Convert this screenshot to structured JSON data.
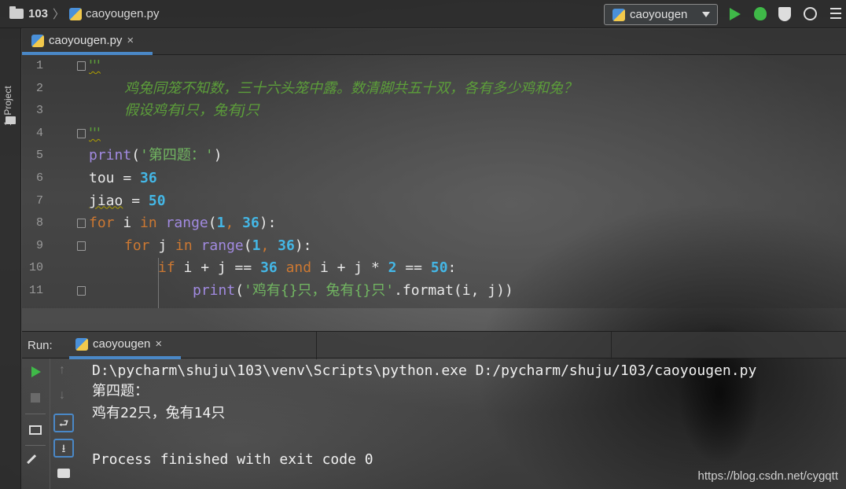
{
  "navbar": {
    "folder": "103",
    "file": "caoyougen.py",
    "run_config": "caoyougen"
  },
  "left_strip": {
    "project_tab": "1: Project"
  },
  "editor_tab": {
    "label": "caoyougen.py",
    "close": "×"
  },
  "editor": {
    "line_numbers": [
      "1",
      "2",
      "3",
      "4",
      "5",
      "6",
      "7",
      "8",
      "9",
      "10",
      "11"
    ],
    "doc_open": "'''",
    "doc_line1": "鸡兔同笼不知数，三十六头笼中露。数清脚共五十双，各有多少鸡和兔？",
    "doc_line2": "假设鸡有i只，兔有j只",
    "doc_close": "'''",
    "l5": {
      "fn": "print",
      "p1": "(",
      "str": "'第四题：'",
      "p2": ")"
    },
    "l6": {
      "var": "tou",
      "op": " = ",
      "num": "36"
    },
    "l7": {
      "var": "jiao",
      "op": " = ",
      "num": "50"
    },
    "l8": {
      "kw1": "for",
      "v": " i ",
      "kw2": "in",
      "sp": " ",
      "fn": "range",
      "p1": "(",
      "n1": "1",
      "c": ", ",
      "n2": "36",
      "p2": "):"
    },
    "l9": {
      "kw1": "for",
      "v": " j ",
      "kw2": "in",
      "sp": " ",
      "fn": "range",
      "p1": "(",
      "n1": "1",
      "c": ", ",
      "n2": "36",
      "p2": "):"
    },
    "l10": {
      "kw1": "if",
      "a": " i + j == ",
      "n1": "36",
      "sp": " ",
      "kw2": "and",
      "b": " i + j * ",
      "n2": "2",
      "c": " == ",
      "n3": "50",
      "d": ":"
    },
    "l11": {
      "fn": "print",
      "p1": "(",
      "str": "'鸡有{}只，兔有{}只'",
      "m": ".format(i, j))"
    }
  },
  "run_panel": {
    "label": "Run:",
    "tab": "caoyougen",
    "close": "×",
    "tools": {
      "up": "↑",
      "down": "↓",
      "wrap": "⮐",
      "scroll": "⭳"
    }
  },
  "console": {
    "lines": [
      "D:\\pycharm\\shuju\\103\\venv\\Scripts\\python.exe D:/pycharm/shuju/103/caoyougen.py",
      "第四题：",
      "鸡有22只，兔有14只",
      "",
      "Process finished with exit code 0"
    ]
  },
  "watermark": "https://blog.csdn.net/cygqtt"
}
